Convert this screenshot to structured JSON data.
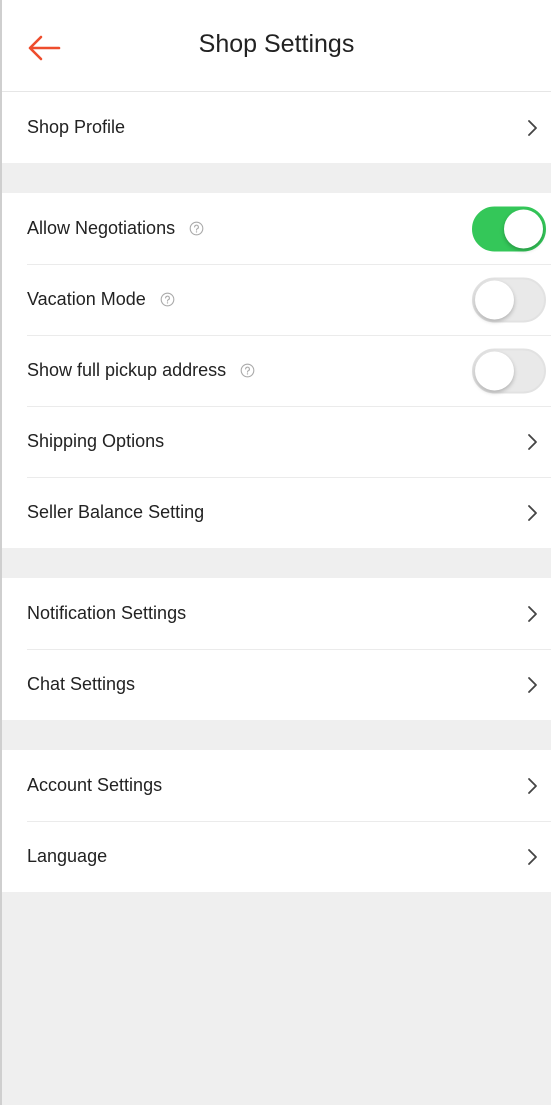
{
  "header": {
    "title": "Shop Settings",
    "back_icon": "arrow-left-icon",
    "accent_color": "#ee4d2d"
  },
  "sections": [
    {
      "items": [
        {
          "label": "Shop Profile",
          "type": "link"
        }
      ]
    },
    {
      "items": [
        {
          "label": "Allow Negotiations",
          "type": "toggle",
          "help": true,
          "value": true
        },
        {
          "label": "Vacation Mode",
          "type": "toggle",
          "help": true,
          "value": false
        },
        {
          "label": "Show full pickup address",
          "type": "toggle",
          "help": true,
          "value": false
        },
        {
          "label": "Shipping Options",
          "type": "link"
        },
        {
          "label": "Seller Balance Setting",
          "type": "link"
        }
      ]
    },
    {
      "items": [
        {
          "label": "Notification Settings",
          "type": "link"
        },
        {
          "label": "Chat Settings",
          "type": "link"
        }
      ]
    },
    {
      "items": [
        {
          "label": "Account Settings",
          "type": "link"
        },
        {
          "label": "Language",
          "type": "link"
        }
      ]
    }
  ],
  "colors": {
    "toggle_on": "#34c759",
    "toggle_off": "#e9e9e9",
    "background": "#efefef"
  }
}
